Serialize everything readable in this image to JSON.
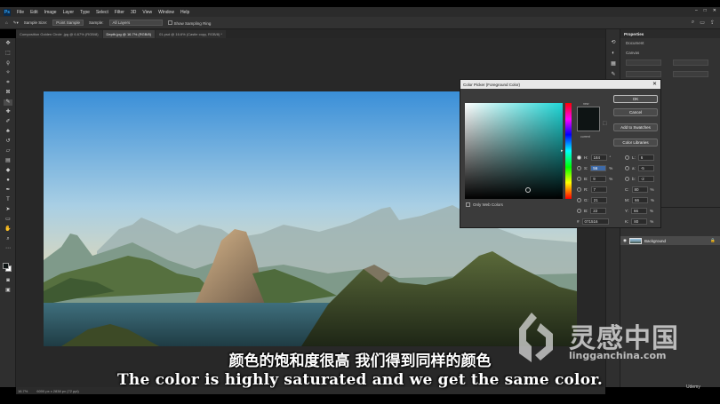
{
  "app": {
    "logo": "Ps",
    "menu": [
      "File",
      "Edit",
      "Image",
      "Layer",
      "Type",
      "Select",
      "Filter",
      "3D",
      "View",
      "Window",
      "Help"
    ]
  },
  "options_bar": {
    "sample_size_label": "Sample Size:",
    "sample_size_value": "Point Sample",
    "sample_label": "Sample:",
    "sample_value": "All Layers",
    "show_ring_label": "Show Sampling Ring"
  },
  "tabs": [
    {
      "label": "Composition Golden Circle .jpg @ 6.67% (RGB/8)",
      "active": false
    },
    {
      "label": "Depth.jpg @ 16.7% (RGB/8)",
      "active": true
    },
    {
      "label": "01.psd @ 16.6% (Castle copy, RGB/8) *",
      "active": false
    }
  ],
  "status_bar": {
    "zoom": "16.7%",
    "doc_size": "6000 px x 2838 px (72 ppi)"
  },
  "properties": {
    "title": "Properties",
    "document_label": "Document",
    "canvas_label": "Canvas"
  },
  "layers": {
    "layer_name": "Background"
  },
  "color_picker": {
    "title": "Color Picker (Foreground Color)",
    "new_label": "new",
    "current_label": "current",
    "ok_label": "OK",
    "cancel_label": "Cancel",
    "add_swatches_label": "Add to Swatches",
    "color_libraries_label": "Color Libraries",
    "only_web_colors_label": "Only Web Colors",
    "fields": {
      "H": "184",
      "H_unit": "°",
      "S": "56",
      "S_unit": "%",
      "B": "9",
      "B_unit": "%",
      "R": "7",
      "G": "21",
      "Bv": "22",
      "L": "6",
      "a": "-5",
      "b": "-2",
      "C": "80",
      "M": "66",
      "Y": "66",
      "K": "80",
      "hex": "071516"
    },
    "new_color": "#0e1414",
    "hue_color": "#1fd6d6"
  },
  "subtitles": {
    "chinese": "颜色的饱和度很高 我们得到同样的颜色",
    "english": "The color is highly saturated and we get the same color."
  },
  "watermark": {
    "chinese": "灵感中国",
    "url": "lingganchina.com"
  },
  "corner_brand": "Udemy"
}
